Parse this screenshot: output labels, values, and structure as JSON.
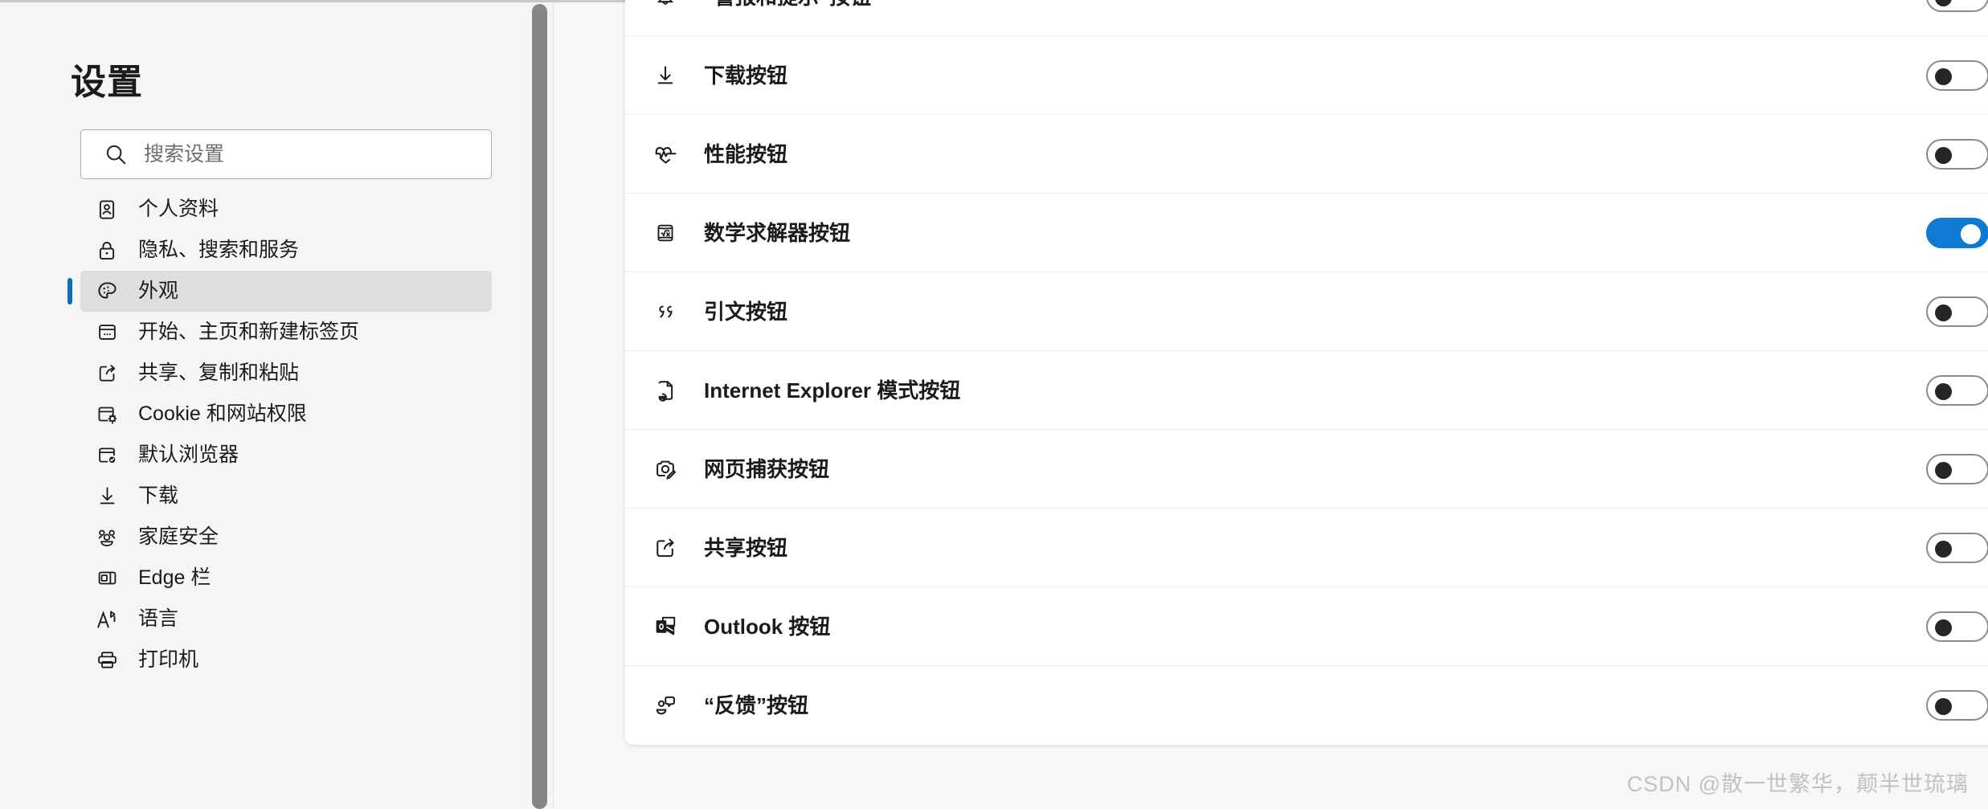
{
  "window": {
    "background_color": "#f5f5f5",
    "accent_color": "#0f7ad4"
  },
  "sidebar": {
    "title": "设置",
    "search": {
      "placeholder": "搜索设置",
      "value": "",
      "icon": "search-icon"
    },
    "items": [
      {
        "label": "个人资料",
        "icon": "profile-icon",
        "selected": false
      },
      {
        "label": "隐私、搜索和服务",
        "icon": "lock-icon",
        "selected": false
      },
      {
        "label": "外观",
        "icon": "palette-icon",
        "selected": true
      },
      {
        "label": "开始、主页和新建标签页",
        "icon": "browser-window-icon",
        "selected": false
      },
      {
        "label": "共享、复制和粘贴",
        "icon": "share-page-icon",
        "selected": false
      },
      {
        "label": "Cookie 和网站权限",
        "icon": "cookie-settings-icon",
        "selected": false
      },
      {
        "label": "默认浏览器",
        "icon": "default-browser-check-icon",
        "selected": false
      },
      {
        "label": "下载",
        "icon": "download-arrow-icon",
        "selected": false
      },
      {
        "label": "家庭安全",
        "icon": "family-people-icon",
        "selected": false
      },
      {
        "label": "Edge 栏",
        "icon": "edge-bar-icon",
        "selected": false
      },
      {
        "label": "语言",
        "icon": "language-a-icon",
        "selected": false
      },
      {
        "label": "打印机",
        "icon": "printer-icon",
        "selected": false
      }
    ]
  },
  "main": {
    "rows": [
      {
        "label": "“警报和提示”按钮",
        "icon": "bell-icon",
        "toggle": "off"
      },
      {
        "label": "下载按钮",
        "icon": "download-arrow-icon",
        "toggle": "off"
      },
      {
        "label": "性能按钮",
        "icon": "heart-pulse-icon",
        "toggle": "off"
      },
      {
        "label": "数学求解器按钮",
        "icon": "math-solver-icon",
        "toggle": "on"
      },
      {
        "label": "引文按钮",
        "icon": "quote-icon",
        "toggle": "off"
      },
      {
        "label": "Internet Explorer 模式按钮",
        "icon": "ie-mode-icon",
        "toggle": "off"
      },
      {
        "label": "网页捕获按钮",
        "icon": "web-capture-icon",
        "toggle": "off"
      },
      {
        "label": "共享按钮",
        "icon": "share-page-icon",
        "toggle": "off"
      },
      {
        "label": "Outlook 按钮",
        "icon": "outlook-icon",
        "toggle": "off"
      },
      {
        "label": "“反馈”按钮",
        "icon": "feedback-icon",
        "toggle": "off"
      }
    ]
  },
  "watermark": {
    "text": "CSDN @散一世繁华，颠半世琉璃"
  }
}
